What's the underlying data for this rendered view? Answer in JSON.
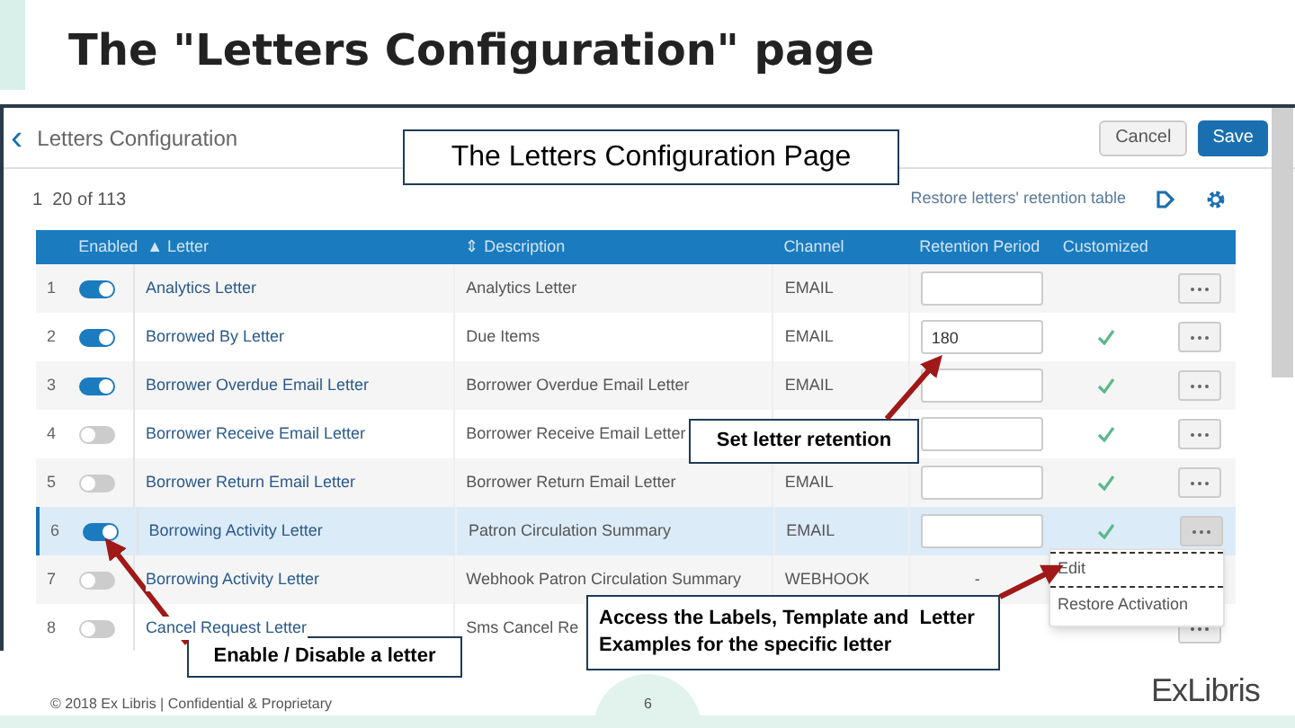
{
  "slide_title": "The \"Letters Configuration\" page",
  "page": {
    "back_icon": "‹",
    "title": "Letters Configuration",
    "buttons": [
      {
        "label": "Cancel",
        "kind": "secondary"
      },
      {
        "label": "Save",
        "kind": "primary"
      }
    ],
    "pagination": "1  20 of 113",
    "restore_link": "Restore letters' retention table"
  },
  "table": {
    "columns": [
      {
        "kind": "number"
      },
      {
        "label": "Enabled",
        "kind": "toggle"
      },
      {
        "label": "▲ Letter",
        "kind": "letter"
      },
      {
        "label": "⇕ Description",
        "kind": "description"
      },
      {
        "label": "Channel",
        "kind": "channel"
      },
      {
        "label": "Retention Period",
        "kind": "retention"
      },
      {
        "label": "Customized",
        "kind": "customized"
      },
      {
        "kind": "actions"
      }
    ],
    "rows": [
      {
        "number": "1",
        "enabled": true,
        "letter": "Analytics Letter",
        "description": "Analytics Letter",
        "channel": "EMAIL",
        "retention": {
          "kind": "input"
        },
        "customized": false,
        "selected": false
      },
      {
        "number": "2",
        "enabled": true,
        "letter": "Borrowed By Letter",
        "description": "Due Items",
        "channel": "EMAIL",
        "retention": {
          "kind": "input",
          "value": "180"
        },
        "customized": true,
        "selected": false
      },
      {
        "number": "3",
        "enabled": true,
        "letter": "Borrower Overdue Email Letter",
        "description": "Borrower Overdue Email Letter",
        "channel": "EMAIL",
        "retention": {
          "kind": "input"
        },
        "customized": true,
        "selected": false
      },
      {
        "number": "4",
        "enabled": false,
        "letter": "Borrower Receive Email Letter",
        "description": "Borrower Receive Email Letter",
        "retention": {
          "kind": "input"
        },
        "customized": true,
        "selected": false
      },
      {
        "number": "5",
        "enabled": false,
        "letter": "Borrower Return Email Letter",
        "description": "Borrower Return Email Letter",
        "channel": "EMAIL",
        "retention": {
          "kind": "input"
        },
        "customized": true,
        "selected": false
      },
      {
        "number": "6",
        "enabled": true,
        "letter": "Borrowing Activity Letter",
        "description": "Patron Circulation Summary",
        "channel": "EMAIL",
        "retention": {
          "kind": "input"
        },
        "customized": true,
        "selected": true
      },
      {
        "number": "7",
        "enabled": false,
        "letter": "Borrowing Activity Letter",
        "description": "Webhook Patron Circulation Summary",
        "channel": "WEBHOOK",
        "retention": {
          "kind": "text",
          "value": "-"
        },
        "customized": false,
        "selected": false,
        "covered_by_menu": true
      },
      {
        "number": "8",
        "enabled": false,
        "letter": "Cancel Request Letter",
        "description": "Sms Cancel Re",
        "customized": false,
        "selected": false
      }
    ]
  },
  "row_menu": {
    "items": [
      {
        "label": "Edit",
        "selected": true
      },
      {
        "label": "Restore Activation",
        "selected": false
      }
    ]
  },
  "callouts": [
    "The Letters Configuration Page",
    "Set letter retention",
    "Enable / Disable a letter",
    "Access the Labels, Template and  Letter Examples for the specific letter"
  ],
  "footer": {
    "copyright": "© 2018 Ex Libris | Confidential & Proprietary",
    "page_number": "6",
    "logo": "ExLibris"
  }
}
